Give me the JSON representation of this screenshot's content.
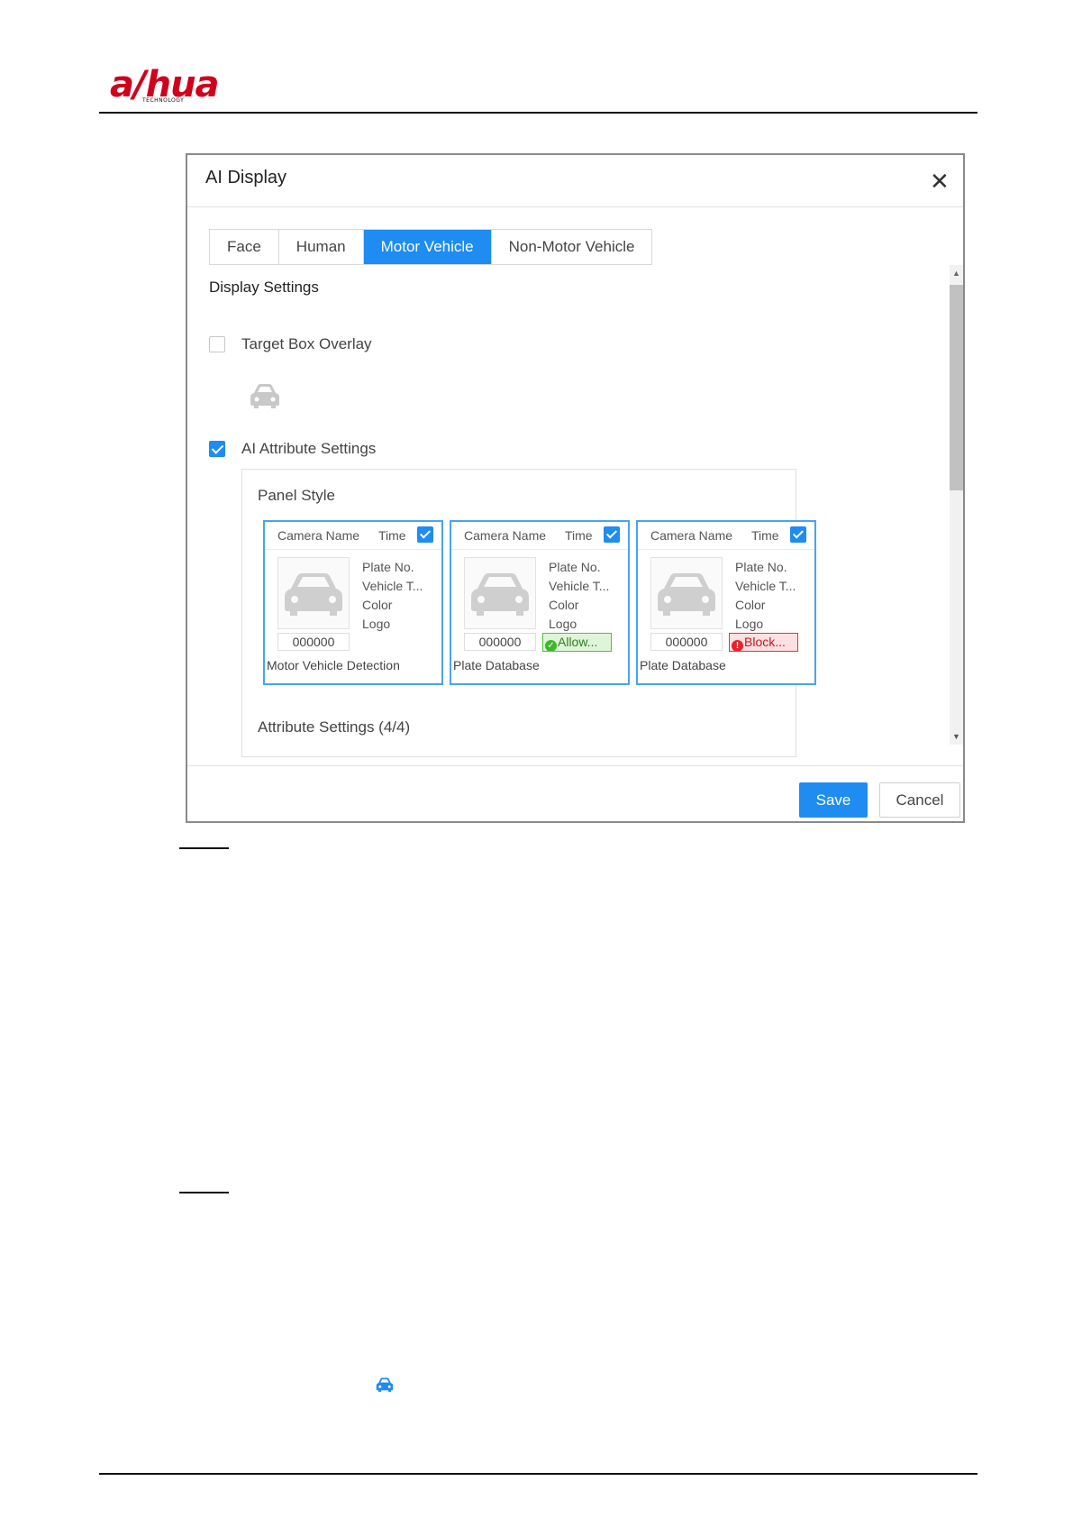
{
  "brand": {
    "logo_text": "a/hua",
    "logo_subtext": "TECHNOLOGY",
    "logo_color": "#d0021b"
  },
  "dialog": {
    "title": "AI Display",
    "close_icon": "close-icon",
    "tabs": [
      {
        "label": "Face",
        "active": false
      },
      {
        "label": "Human",
        "active": false
      },
      {
        "label": "Motor Vehicle",
        "active": true
      },
      {
        "label": "Non-Motor Vehicle",
        "active": false
      }
    ],
    "display_settings_title": "Display Settings",
    "target_box_overlay": {
      "label": "Target Box Overlay",
      "checked": false
    },
    "ai_attribute_settings": {
      "label": "AI Attribute Settings",
      "checked": true
    },
    "panel_style_title": "Panel Style",
    "cards": [
      {
        "camera_name": "Camera Name",
        "time": "Time",
        "attributes": [
          "Plate No.",
          "Vehicle T...",
          "Color",
          "Logo"
        ],
        "plate": "000000",
        "status": "",
        "status_type": "none",
        "footer": "Motor Vehicle Detection"
      },
      {
        "camera_name": "Camera Name",
        "time": "Time",
        "attributes": [
          "Plate No.",
          "Vehicle T...",
          "Color",
          "Logo"
        ],
        "plate": "000000",
        "status": "Allow...",
        "status_type": "allow",
        "footer": "Plate Database"
      },
      {
        "camera_name": "Camera Name",
        "time": "Time",
        "attributes": [
          "Plate No.",
          "Vehicle T...",
          "Color",
          "Logo"
        ],
        "plate": "000000",
        "status": "Block...",
        "status_type": "block",
        "footer": "Plate Database"
      }
    ],
    "attribute_settings_title": "Attribute Settings (4/4)",
    "save_label": "Save",
    "cancel_label": "Cancel",
    "accent_color": "#1e8cf0"
  },
  "bottom_icon": "car-icon"
}
